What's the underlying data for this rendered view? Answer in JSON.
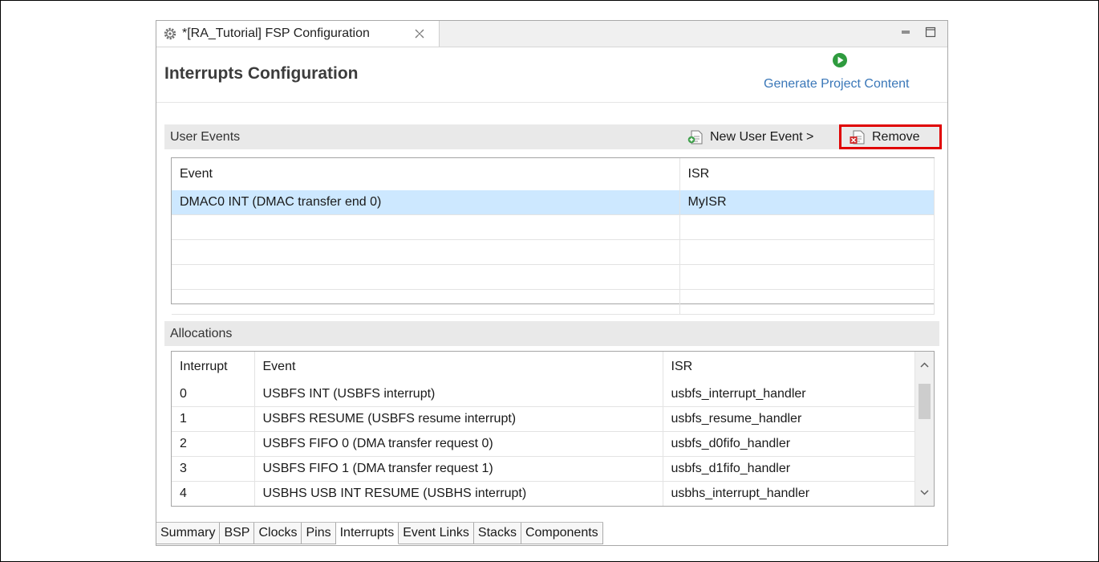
{
  "window": {
    "tab_title": "*[RA_Tutorial] FSP Configuration",
    "page_title": "Interrupts Configuration",
    "generate_label": "Generate Project Content"
  },
  "user_events": {
    "header": "User Events",
    "new_button": "New User Event >",
    "remove_button": "Remove",
    "columns": [
      "Event",
      "ISR"
    ],
    "rows": [
      {
        "event": "DMAC0 INT (DMAC transfer end 0)",
        "isr": "MyISR"
      },
      {
        "event": "",
        "isr": ""
      },
      {
        "event": "",
        "isr": ""
      },
      {
        "event": "",
        "isr": ""
      },
      {
        "event": "",
        "isr": ""
      }
    ]
  },
  "allocations": {
    "header": "Allocations",
    "columns": [
      "Interrupt",
      "Event",
      "ISR"
    ],
    "rows": [
      {
        "interrupt": "0",
        "event": "USBFS INT (USBFS interrupt)",
        "isr": "usbfs_interrupt_handler"
      },
      {
        "interrupt": "1",
        "event": "USBFS RESUME (USBFS resume interrupt)",
        "isr": "usbfs_resume_handler"
      },
      {
        "interrupt": "2",
        "event": "USBFS FIFO 0 (DMA transfer request 0)",
        "isr": "usbfs_d0fifo_handler"
      },
      {
        "interrupt": "3",
        "event": "USBFS FIFO 1 (DMA transfer request 1)",
        "isr": "usbfs_d1fifo_handler"
      },
      {
        "interrupt": "4",
        "event": "USBHS USB INT RESUME (USBHS interrupt)",
        "isr": "usbhs_interrupt_handler"
      }
    ]
  },
  "bottom_tabs": [
    "Summary",
    "BSP",
    "Clocks",
    "Pins",
    "Interrupts",
    "Event Links",
    "Stacks",
    "Components"
  ],
  "active_tab": "Interrupts",
  "colors": {
    "link": "#3a77b8",
    "selection": "#cde8ff",
    "remove_highlight": "#e00000",
    "generate_icon": "#2e9b3e"
  },
  "icons": [
    "gear-icon",
    "close-tab-icon",
    "minimize-icon",
    "maximize-icon",
    "generate-icon",
    "new-event-icon",
    "remove-icon",
    "scroll-up-icon",
    "scroll-down-icon"
  ]
}
